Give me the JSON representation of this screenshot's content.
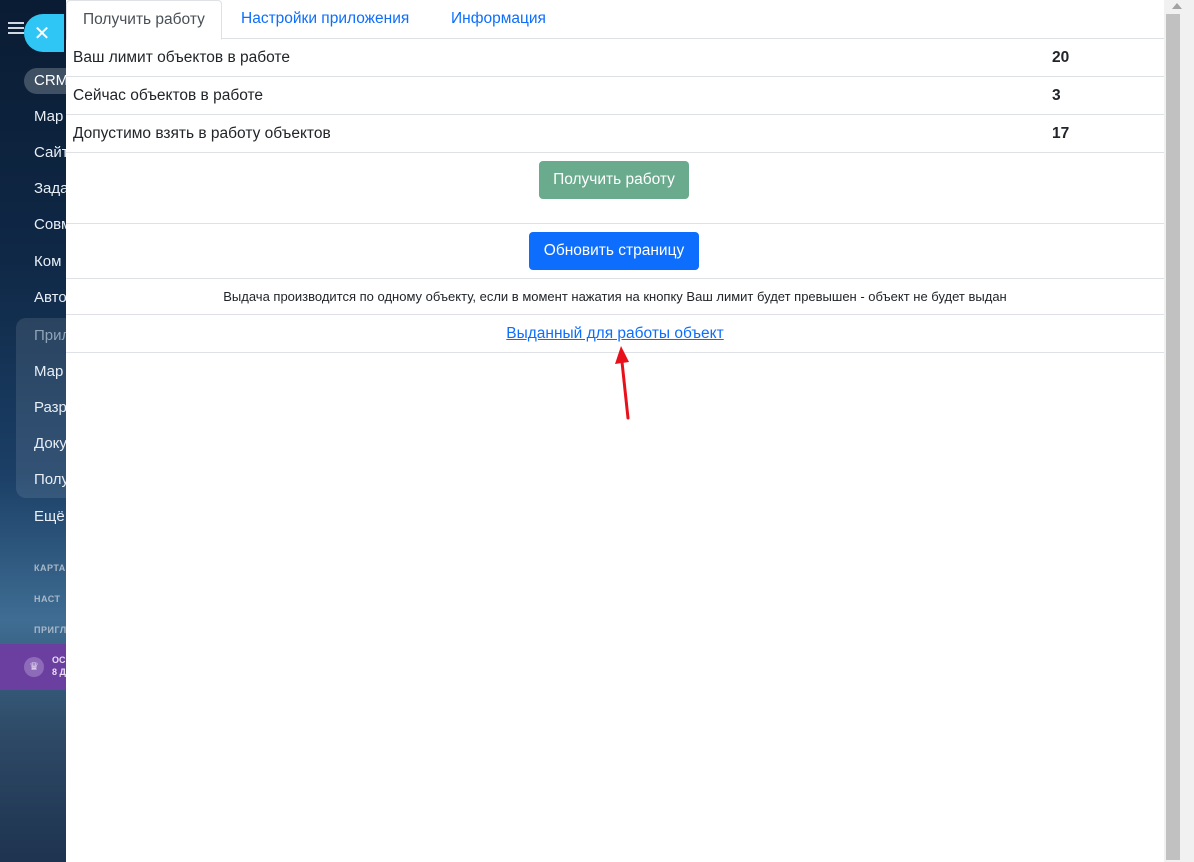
{
  "sidebar": {
    "pill": "CRM",
    "items": [
      "Мар",
      "Сайт",
      "Зада",
      "Совм",
      "Ком",
      "Авто",
      "Прил",
      "Мар",
      "Разр",
      "Доку",
      "Полу",
      "Ещё"
    ],
    "small_items": [
      "КАРТА",
      "НАСТ",
      "ПРИГЛ"
    ],
    "promo": [
      "ОС",
      "8 Д"
    ]
  },
  "tabs": [
    {
      "label": "Получить работу",
      "active": true
    },
    {
      "label": "Настройки приложения",
      "active": false
    },
    {
      "label": "Информация",
      "active": false
    }
  ],
  "stats": [
    {
      "label": "Ваш лимит объектов в работе",
      "value": "20"
    },
    {
      "label": "Сейчас объектов в работе",
      "value": "3"
    },
    {
      "label": "Допустимо взять в работу объектов",
      "value": "17"
    }
  ],
  "buttons": {
    "get_work": "Получить работу",
    "refresh": "Обновить страницу"
  },
  "notice": "Выдача производится по одному объекту, если в момент нажатия на кнопку Ваш лимит будет превышен - объект не будет выдан",
  "issued_link": "Выданный для работы объект",
  "colors": {
    "primary": "#0d6efd",
    "get_button": "#6aab8d",
    "annotation_arrow": "#e8101a",
    "close_button": "#2fc6f6"
  }
}
